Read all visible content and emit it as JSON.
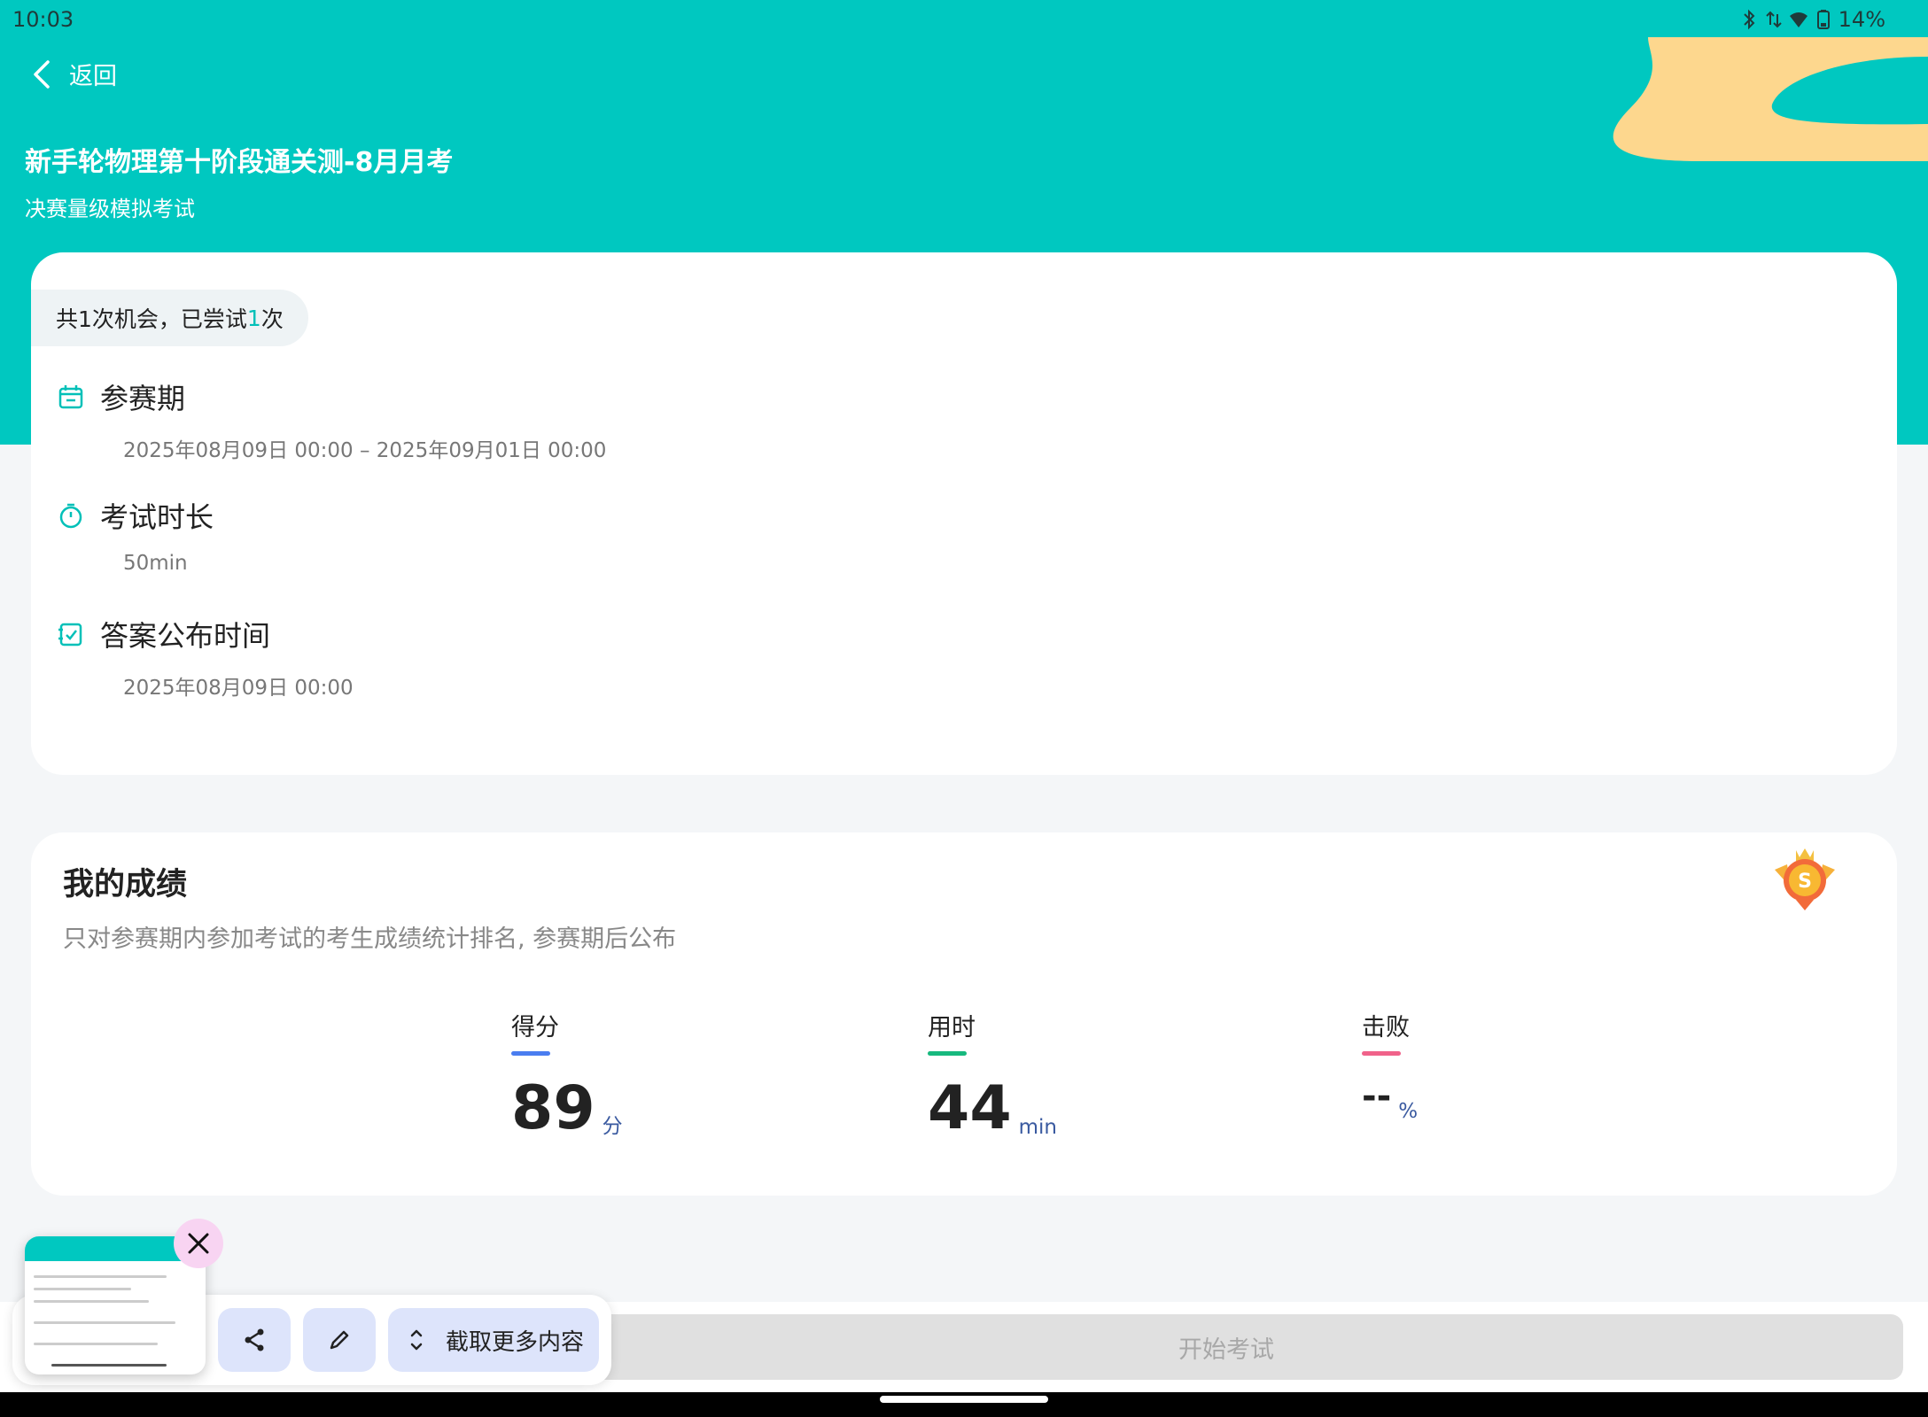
{
  "status_bar": {
    "time": "10:03",
    "battery": "14%",
    "icons": [
      "bluetooth-icon",
      "data-arrows-icon",
      "wifi-icon",
      "battery-icon"
    ]
  },
  "header": {
    "back_label": "返回",
    "title": "新手轮物理第十阶段通关测-8月月考",
    "subtitle": "决赛量级模拟考试"
  },
  "attempts": {
    "prefix": "共1次机会，已尝试",
    "count": "1",
    "suffix": "次"
  },
  "info": [
    {
      "label": "参赛期",
      "value": "2025年08月09日 00:00  –  2025年09月01日 00:00",
      "icon": "calendar-icon"
    },
    {
      "label": "考试时长",
      "value": "50min",
      "icon": "stopwatch-icon"
    },
    {
      "label": "答案公布时间",
      "value": "2025年08月09日 00:00",
      "icon": "checklist-icon"
    }
  ],
  "score": {
    "title": "我的成绩",
    "note": "只对参赛期内参加考试的考生成绩统计排名, 参赛期后公布",
    "stats": [
      {
        "label": "得分",
        "value": "89",
        "unit": "分",
        "color": "#4a7df0"
      },
      {
        "label": "用时",
        "value": "44",
        "unit": "min",
        "color": "#17b97e"
      },
      {
        "label": "击败",
        "value": "--",
        "unit": "%",
        "color": "#f0628a"
      }
    ]
  },
  "start_button": "开始考试",
  "screenshot_toolbar": {
    "more_label": "截取更多内容"
  },
  "colors": {
    "primary": "#00c8c0",
    "accent_sand": "#fdd78e"
  }
}
